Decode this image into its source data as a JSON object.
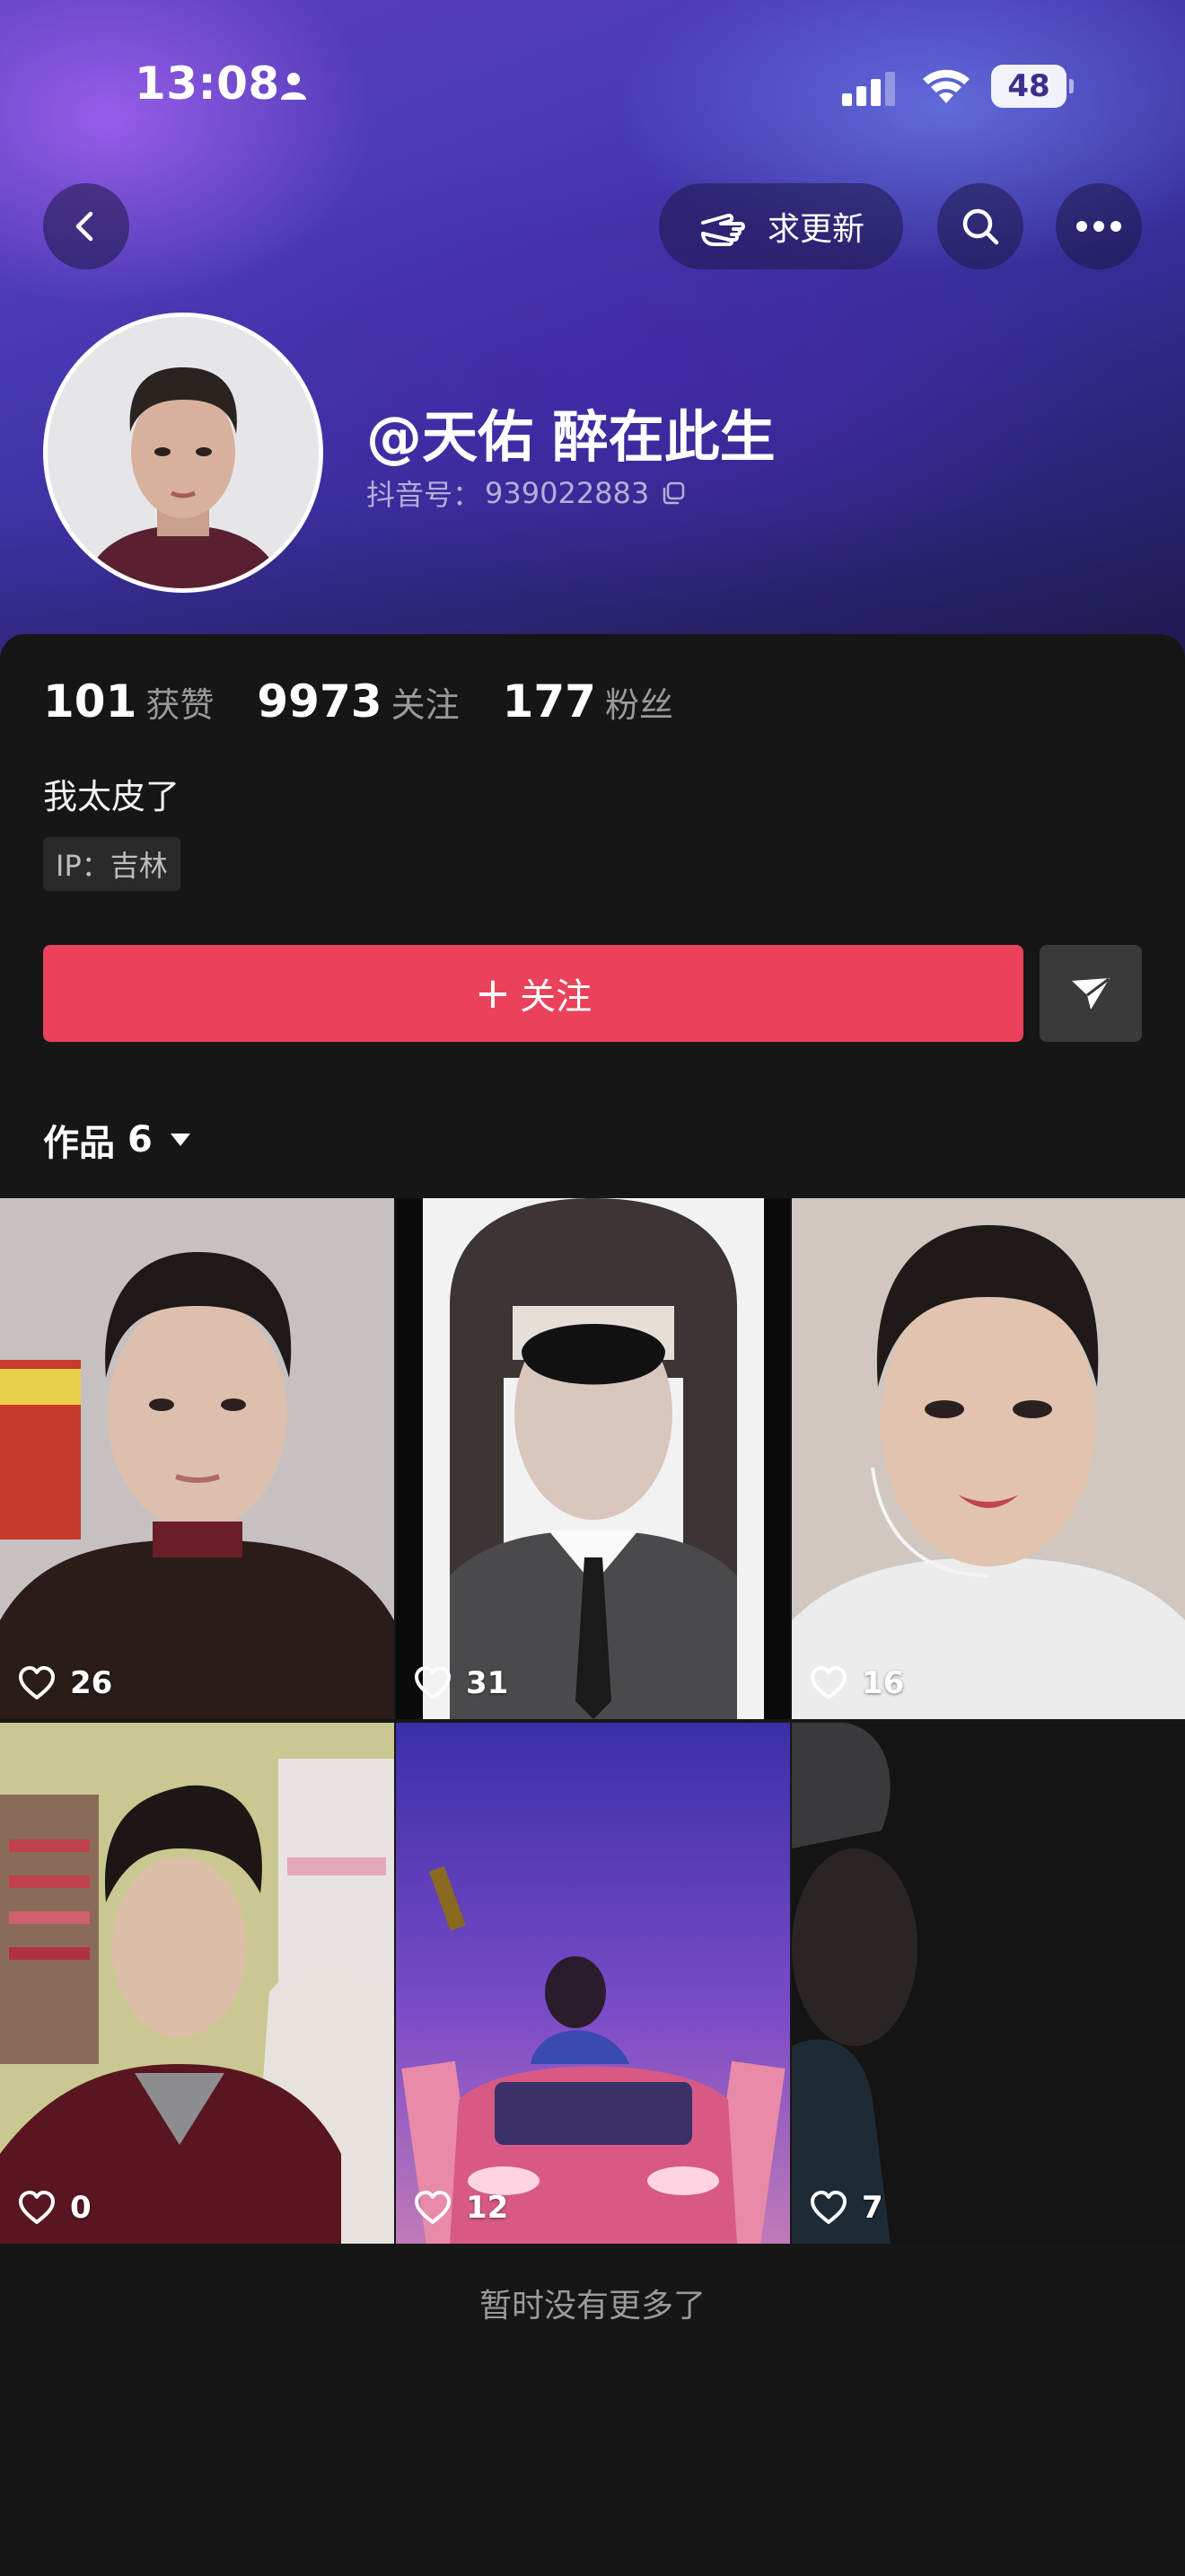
{
  "status_bar": {
    "time": "13:08",
    "battery": "48",
    "icons": [
      "person-icon",
      "cellular-signal-icon",
      "wifi-icon",
      "battery-icon"
    ]
  },
  "nav": {
    "back_icon": "chevron-left-icon",
    "request_update_label": "求更新",
    "request_update_icon": "pointing-hand-icon",
    "search_icon": "search-icon",
    "more_icon": "more-dots-icon"
  },
  "profile": {
    "username": "@天佑 醉在此生",
    "id_label": "抖音号：",
    "id_value": "939022883",
    "bio": "我太皮了",
    "ip_label": "IP：吉林"
  },
  "stats": [
    {
      "value": "101",
      "label": "获赞"
    },
    {
      "value": "9973",
      "label": "关注"
    },
    {
      "value": "177",
      "label": "粉丝"
    }
  ],
  "actions": {
    "follow_plus": "+",
    "follow_label": "关注",
    "share_icon": "paper-plane-icon"
  },
  "works_tab": {
    "label": "作品",
    "count": "6"
  },
  "videos": [
    {
      "likes": "26"
    },
    {
      "likes": "31"
    },
    {
      "likes": "16"
    },
    {
      "likes": "0"
    },
    {
      "likes": "12"
    },
    {
      "likes": "7"
    }
  ],
  "footer_note": "暂时没有更多了",
  "colors": {
    "accent": "#e9425a",
    "background": "#161616",
    "hero_purple": "#4a3ab5"
  }
}
